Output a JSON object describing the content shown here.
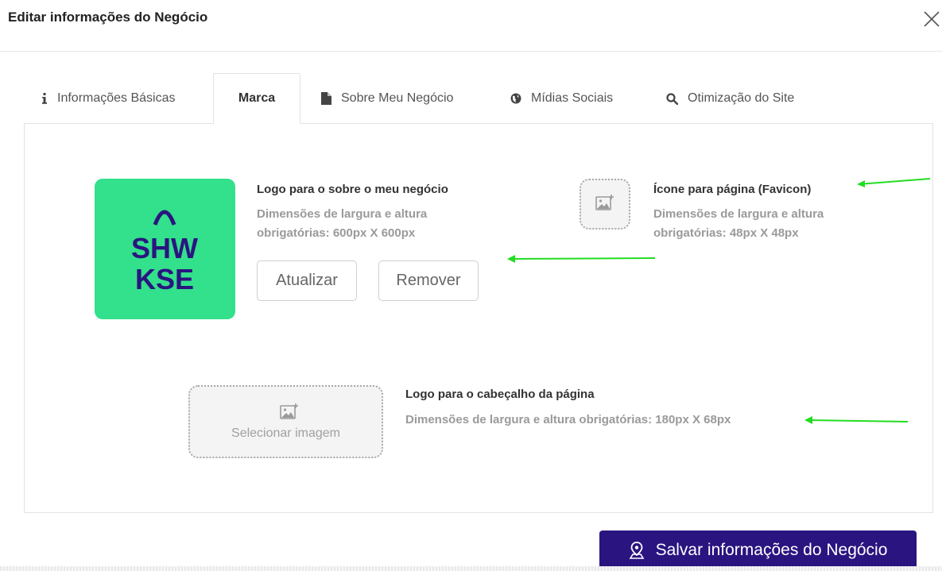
{
  "modal": {
    "title": "Editar informações do Negócio",
    "close_icon": "close-icon"
  },
  "tabs": [
    {
      "label": "Informações Básicas",
      "icon": "info-icon",
      "active": false
    },
    {
      "label": "Marca",
      "icon": null,
      "active": true
    },
    {
      "label": "Sobre Meu Negócio",
      "icon": "document-icon",
      "active": false
    },
    {
      "label": "Mídias Sociais",
      "icon": "globe-icon",
      "active": false
    },
    {
      "label": "Otimização do Site",
      "icon": "search-icon",
      "active": false
    }
  ],
  "about_logo": {
    "logo_text_line1": "SHW",
    "logo_text_line2": "KSE",
    "title": "Logo para o sobre o meu negócio",
    "desc_line1": "Dimensões de largura e altura",
    "desc_line2": "obrigatórias: 600px X 600px",
    "update_label": "Atualizar",
    "remove_label": "Remover"
  },
  "favicon": {
    "title": "Ícone para página (Favicon)",
    "desc_line1": "Dimensões de largura e altura",
    "desc_line2": "obrigatórias: 48px X 48px"
  },
  "header_logo": {
    "select_label": "Selecionar imagem",
    "title": "Logo para o cabeçalho da página",
    "desc": "Dimensões de largura e altura obrigatórias: 180px X 68px"
  },
  "save_button": {
    "label": "Salvar informações do Negócio",
    "icon": "map-pin-icon"
  },
  "colors": {
    "brand_green": "#33e08b",
    "logo_text": "#2a1480",
    "save_button_bg": "#2a1480",
    "annotation_arrow": "#22dd22"
  }
}
